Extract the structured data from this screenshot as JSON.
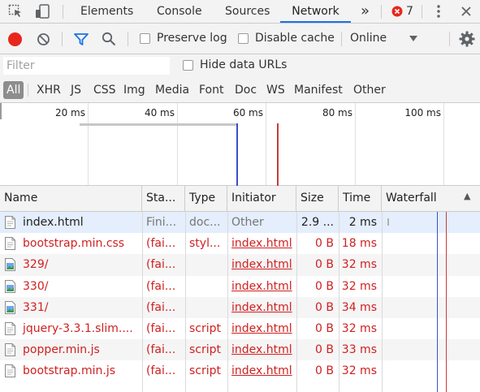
{
  "tabbar": {
    "tabs": [
      "Elements",
      "Console",
      "Sources",
      "Network"
    ],
    "active_tab": "Network",
    "more_label": "»",
    "error_count": "7"
  },
  "toolbar": {
    "preserve_log": "Preserve log",
    "disable_cache": "Disable cache",
    "throttle": "Online",
    "record_color": "#e8261b"
  },
  "filter": {
    "placeholder": "Filter",
    "hide_data_urls": "Hide data URLs"
  },
  "types": [
    "All",
    "XHR",
    "JS",
    "CSS",
    "Img",
    "Media",
    "Font",
    "Doc",
    "WS",
    "Manifest",
    "Other"
  ],
  "overview": {
    "ticks": [
      "20 ms",
      "40 ms",
      "60 ms",
      "80 ms",
      "100 ms"
    ],
    "dom_content_loaded_color": "#3b50c8",
    "load_color": "#c83b3b"
  },
  "table": {
    "columns": [
      "Name",
      "Sta...",
      "Type",
      "Initiator",
      "Size",
      "Time",
      "Waterfall"
    ],
    "sort_indicator": "▲",
    "rows": [
      {
        "name": "index.html",
        "status": "Fini...",
        "type": "doc...",
        "initiator": "Other",
        "size": "2.9 ...",
        "time": "2 ms",
        "icon": "document-icon",
        "failed": false
      },
      {
        "name": "bootstrap.min.css",
        "status": "(fai...",
        "type": "styl...",
        "initiator": "index.html",
        "size": "0 B",
        "time": "18 ms",
        "icon": "document-icon",
        "failed": true
      },
      {
        "name": "329/",
        "status": "(fai...",
        "type": "",
        "initiator": "index.html",
        "size": "0 B",
        "time": "32 ms",
        "icon": "image-icon",
        "failed": true
      },
      {
        "name": "330/",
        "status": "(fai...",
        "type": "",
        "initiator": "index.html",
        "size": "0 B",
        "time": "32 ms",
        "icon": "image-icon",
        "failed": true
      },
      {
        "name": "331/",
        "status": "(fai...",
        "type": "",
        "initiator": "index.html",
        "size": "0 B",
        "time": "34 ms",
        "icon": "image-icon",
        "failed": true
      },
      {
        "name": "jquery-3.3.1.slim....",
        "status": "(fai...",
        "type": "script",
        "initiator": "index.html",
        "size": "0 B",
        "time": "32 ms",
        "icon": "document-icon",
        "failed": true
      },
      {
        "name": "popper.min.js",
        "status": "(fai...",
        "type": "script",
        "initiator": "index.html",
        "size": "0 B",
        "time": "33 ms",
        "icon": "document-icon",
        "failed": true
      },
      {
        "name": "bootstrap.min.js",
        "status": "(fai...",
        "type": "script",
        "initiator": "index.html",
        "size": "0 B",
        "time": "32 ms",
        "icon": "document-icon",
        "failed": true
      }
    ]
  }
}
